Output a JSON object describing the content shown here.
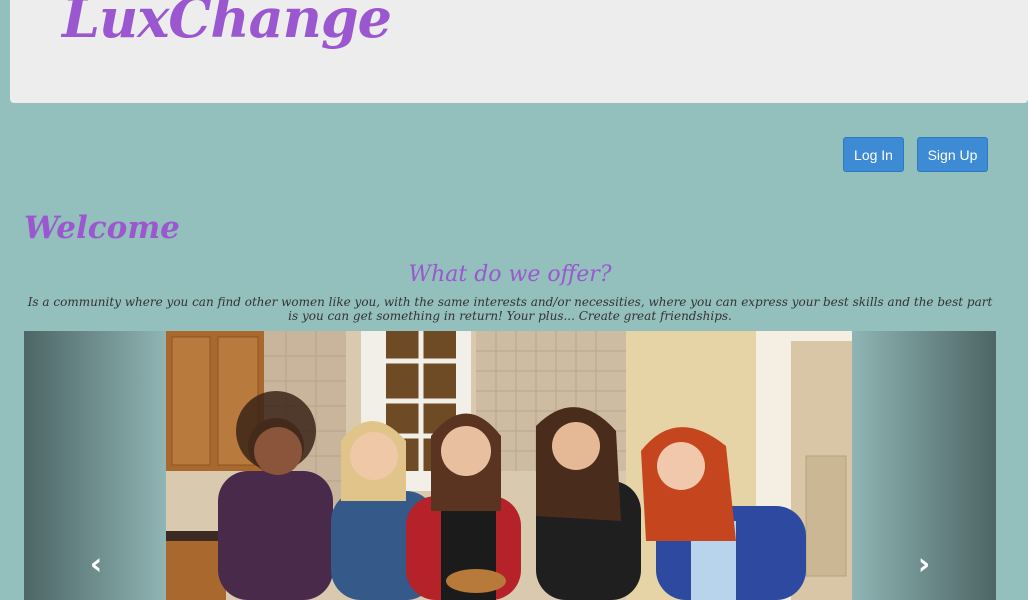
{
  "header": {
    "logo": "LuxChange"
  },
  "auth": {
    "login_label": "Log In",
    "signup_label": "Sign Up"
  },
  "main": {
    "welcome": "Welcome",
    "offer_title": "What do we offer?",
    "offer_text": "Is a community where you can find other women like you, with the same interests and/or necessities, where you can express your best skills and the best part is you can get something in return! Your plus... Create great friendships."
  },
  "carousel": {
    "prev_icon": "chevron-left-icon",
    "next_icon": "chevron-right-icon"
  },
  "colors": {
    "brand": "#9a57cf",
    "background": "#93bfbd",
    "button": "#3d8bd4",
    "header_bg": "#ededed"
  }
}
